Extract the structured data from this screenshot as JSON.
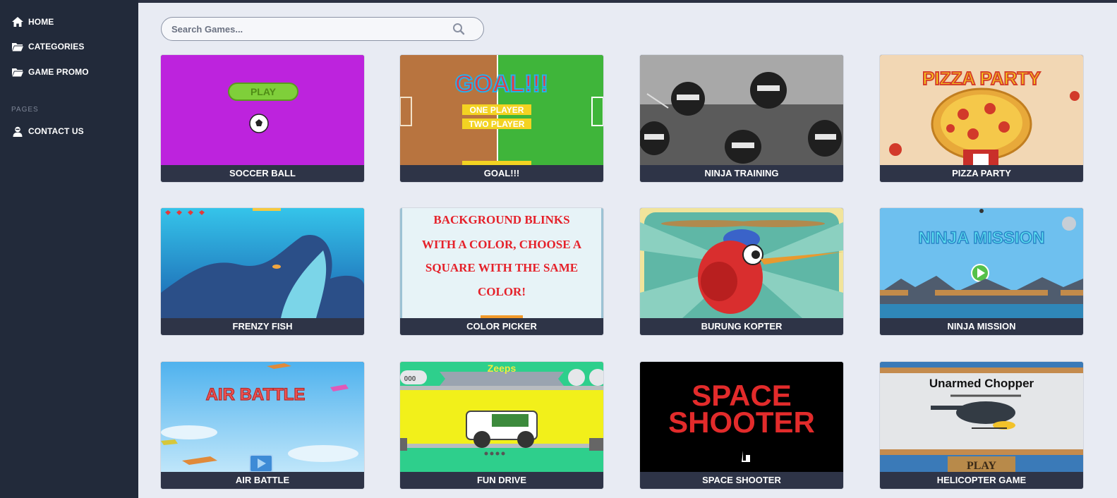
{
  "sidebar": {
    "items": [
      {
        "label": "HOME",
        "icon": "home-icon"
      },
      {
        "label": "CATEGORIES",
        "icon": "folder-icon"
      },
      {
        "label": "GAME PROMO",
        "icon": "folder-icon"
      }
    ],
    "section_label": "PAGES",
    "pages": [
      {
        "label": "CONTACT US",
        "icon": "user-icon"
      }
    ]
  },
  "search": {
    "placeholder": "Search Games..."
  },
  "games": [
    {
      "title": "SOCCER BALL",
      "thumb_text": [
        "PLAY"
      ]
    },
    {
      "title": "GOAL!!!",
      "thumb_text": [
        "GOAL!!!",
        "ONE PLAYER",
        "TWO PLAYER"
      ]
    },
    {
      "title": "NINJA TRAINING",
      "thumb_text": []
    },
    {
      "title": "PIZZA PARTY",
      "thumb_text": [
        "PIZZA PARTY"
      ]
    },
    {
      "title": "FRENZY FISH",
      "thumb_text": []
    },
    {
      "title": "COLOR PICKER",
      "thumb_text": [
        "BACKGROUND BLINKS",
        "WITH A COLOR, CHOOSE A",
        "SQUARE WITH THE SAME",
        "COLOR!"
      ]
    },
    {
      "title": "BURUNG KOPTER",
      "thumb_text": []
    },
    {
      "title": "NINJA MISSION",
      "thumb_text": [
        "NINJA MISSION"
      ]
    },
    {
      "title": "AIR BATTLE",
      "thumb_text": [
        "AIR BATTLE"
      ]
    },
    {
      "title": "FUN DRIVE",
      "thumb_text": [
        "Zeeps",
        "000"
      ]
    },
    {
      "title": "SPACE SHOOTER",
      "thumb_text": [
        "SPACE",
        "SHOOTER"
      ]
    },
    {
      "title": "HELICOPTER GAME",
      "thumb_text": [
        "Unarmed Chopper",
        "PLAY"
      ]
    }
  ],
  "colors": {
    "sidebar_bg": "#222a3a",
    "main_bg": "#e8ebf3",
    "card_title_bg": "#2e3447"
  }
}
